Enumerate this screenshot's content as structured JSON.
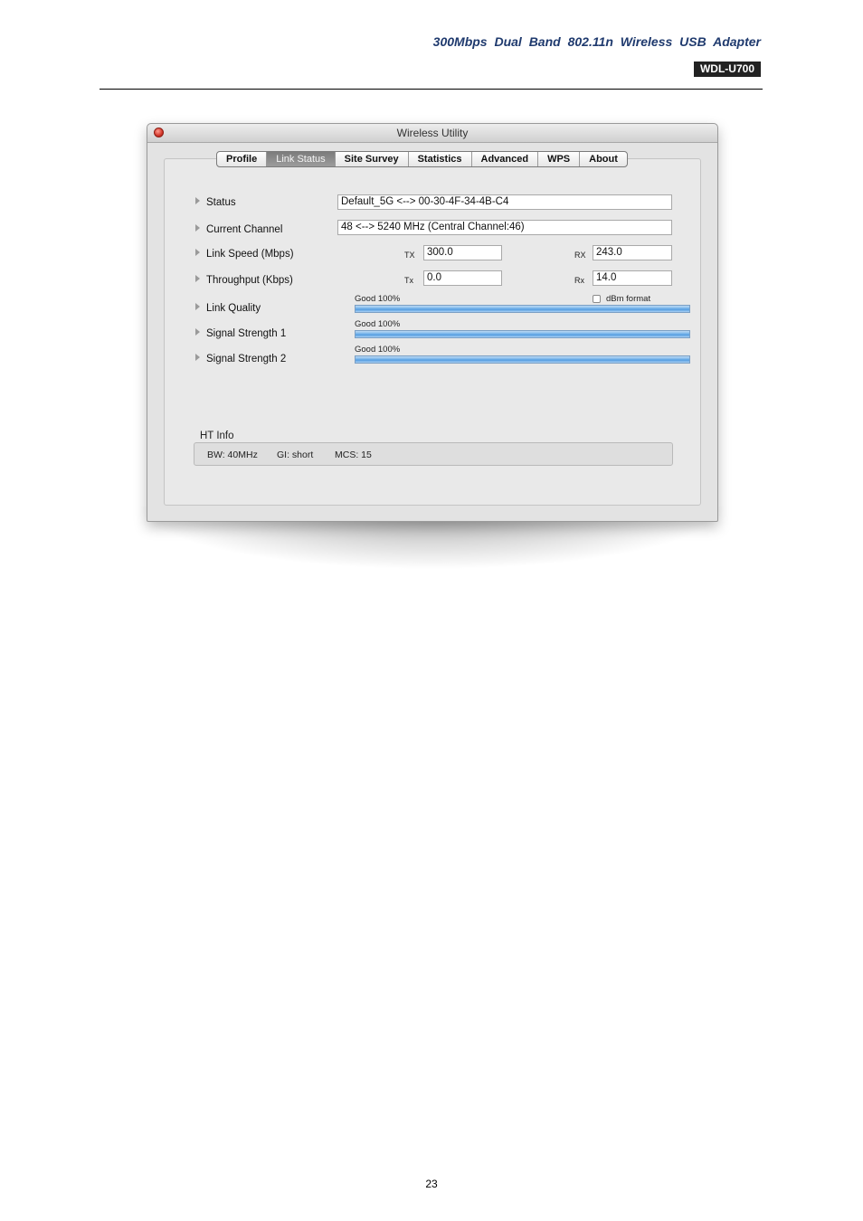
{
  "doc_header": {
    "title": "300Mbps Dual Band 802.11n Wireless USB Adapter",
    "model": "WDL-U700"
  },
  "page_number": "23",
  "window": {
    "title": "Wireless Utility",
    "tabs": [
      {
        "label": "Profile",
        "active": false
      },
      {
        "label": "Link Status",
        "active": true
      },
      {
        "label": "Site Survey",
        "active": false
      },
      {
        "label": "Statistics",
        "active": false
      },
      {
        "label": "Advanced",
        "active": false
      },
      {
        "label": "WPS",
        "active": false
      },
      {
        "label": "About",
        "active": false
      }
    ],
    "link_status": {
      "status_label": "Status",
      "status_value": "Default_5G <--> 00-30-4F-34-4B-C4",
      "channel_label": "Current Channel",
      "channel_value": "48 <--> 5240 MHz (Central Channel:46)",
      "link_speed_label": "Link Speed (Mbps)",
      "link_speed_tx_label": "TX",
      "link_speed_tx": "300.0",
      "link_speed_rx_label": "RX",
      "link_speed_rx": "243.0",
      "throughput_label": "Throughput (Kbps)",
      "throughput_tx_label": "Tx",
      "throughput_tx": "0.0",
      "throughput_rx_label": "Rx",
      "throughput_rx": "14.0",
      "dbm_format_label": "dBm format",
      "dbm_format_checked": false,
      "link_quality_label": "Link Quality",
      "link_quality_caption": "Good 100%",
      "link_quality_percent": 100,
      "signal1_label": "Signal Strength 1",
      "signal1_caption": "Good 100%",
      "signal1_percent": 100,
      "signal2_label": "Signal Strength 2",
      "signal2_caption": "Good 100%",
      "signal2_percent": 100
    },
    "ht_info": {
      "label": "HT Info",
      "bw": "BW: 40MHz",
      "gi": "GI: short",
      "mcs": "MCS: 15"
    }
  }
}
